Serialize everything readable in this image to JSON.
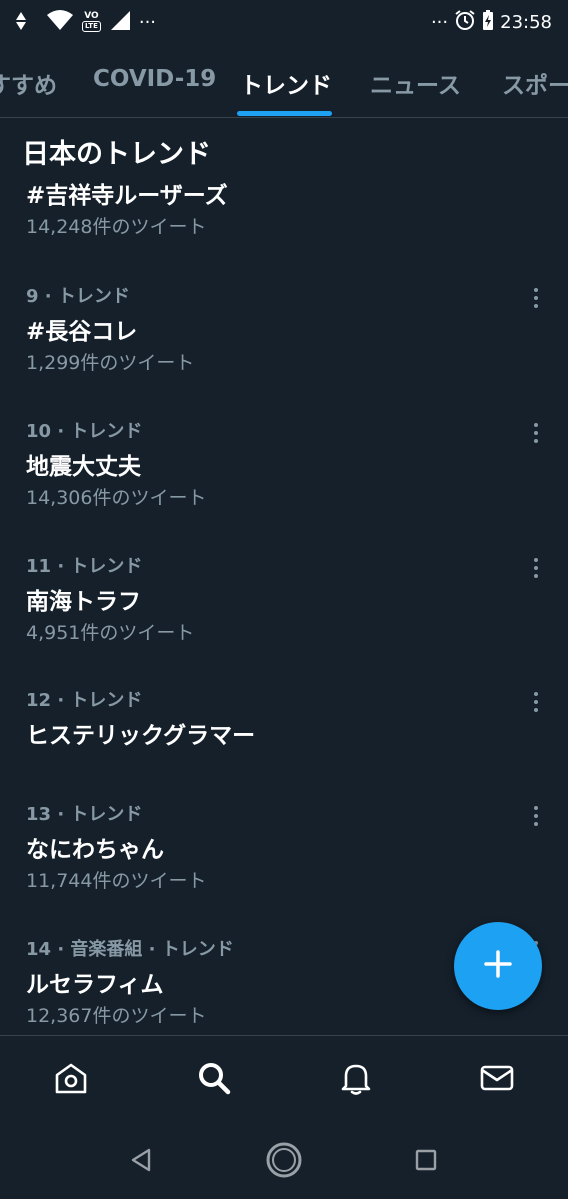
{
  "status_bar": {
    "volte_top": "VO",
    "volte_bottom": "LTE",
    "left_dots": "···",
    "right_dots": "···",
    "time": "23:58"
  },
  "tabs": [
    {
      "label": "すすめ",
      "active": false
    },
    {
      "label": "COVID-19",
      "active": false
    },
    {
      "label": "トレンド",
      "active": true
    },
    {
      "label": "ニュース",
      "active": false
    },
    {
      "label": "スポー",
      "active": false
    }
  ],
  "section_title": "日本のトレンド",
  "partial_trend": {
    "name": "#吉祥寺ルーザーズ",
    "count": "14,248件のツイート"
  },
  "trends": [
    {
      "meta": "9 · トレンド",
      "name": "#長谷コレ",
      "count": "1,299件のツイート"
    },
    {
      "meta": "10 · トレンド",
      "name": "地震大丈夫",
      "count": "14,306件のツイート"
    },
    {
      "meta": "11 · トレンド",
      "name": "南海トラフ",
      "count": "4,951件のツイート"
    },
    {
      "meta": "12 · トレンド",
      "name": "ヒステリックグラマー",
      "count": ""
    },
    {
      "meta": "13 · トレンド",
      "name": "なにわちゃん",
      "count": "11,744件のツイート"
    },
    {
      "meta": "14 · 音楽番組 · トレンド",
      "name": "ルセラフィム",
      "count": "12,367件のツイート"
    }
  ],
  "fab_icon": "plus-icon",
  "bottom_nav": [
    {
      "icon": "home-icon"
    },
    {
      "icon": "search-icon",
      "active": true
    },
    {
      "icon": "bell-icon"
    },
    {
      "icon": "mail-icon"
    }
  ],
  "colors": {
    "background": "#15202b",
    "accent": "#1da1f2",
    "secondary_text": "#8899a6",
    "divider": "#38444d"
  }
}
